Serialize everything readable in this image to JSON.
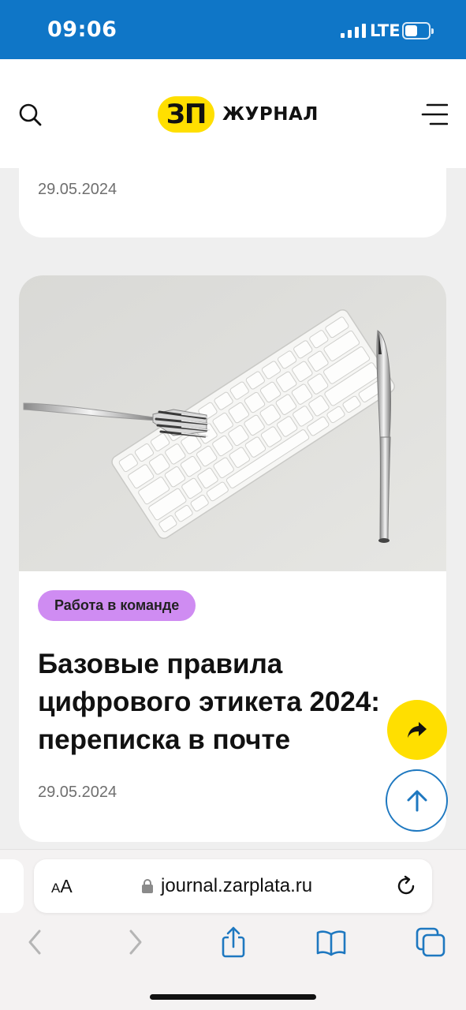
{
  "status_bar": {
    "time": "09:06",
    "network": "LTE",
    "signal_icon": "cellular-signal-icon",
    "battery_icon": "battery-icon",
    "battery_level": 0.55
  },
  "header": {
    "logo_badge": "ЗП",
    "logo_text": "ЖУРНАЛ",
    "search_icon": "search-icon",
    "menu_icon": "hamburger-menu-icon",
    "brand_color": "#ffdf00"
  },
  "articles": [
    {
      "date": "29.05.2024"
    },
    {
      "image": "keyboard-with-fork-and-knife-photo",
      "tag": "Работа в команде",
      "tag_color": "#cf8cf2",
      "title_lines": [
        "Базовые правила",
        "цифрового этикета 2024:",
        "переписка в почте"
      ],
      "date": "29.05.2024"
    }
  ],
  "fabs": {
    "share_icon": "share-arrow-icon",
    "scroll_top_icon": "arrow-up-icon",
    "accent": "#1e78c0"
  },
  "browser": {
    "text_size_button": {
      "small": "A",
      "large": "A"
    },
    "lock_icon": "lock-icon",
    "url": "journal.zarplata.ru",
    "reload_icon": "reload-icon",
    "toolbar_icons": [
      "back-chevron-icon",
      "forward-chevron-icon",
      "share-icon",
      "bookmarks-icon",
      "tabs-icon"
    ],
    "tint": "#1e78c0"
  }
}
